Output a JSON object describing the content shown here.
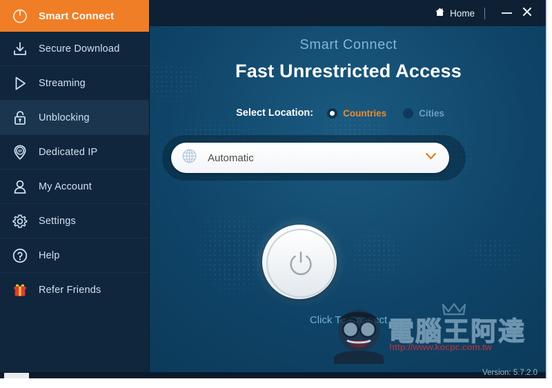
{
  "window": {
    "titlebar": {
      "home_label": "Home",
      "home_icon": "home-icon",
      "minimize_icon": "minimize-icon",
      "close_icon": "close-icon"
    },
    "version_text": "Version: 5.7.2.0"
  },
  "sidebar": {
    "header": {
      "label": "Smart Connect",
      "icon": "power-icon",
      "bg_color": "#ef7e27"
    },
    "items": [
      {
        "label": "Secure Download",
        "icon": "download-icon",
        "active": false
      },
      {
        "label": "Streaming",
        "icon": "play-icon",
        "active": false
      },
      {
        "label": "Unblocking",
        "icon": "unlock-icon",
        "active": true
      },
      {
        "label": "Dedicated IP",
        "icon": "ip-pin-icon",
        "active": false
      },
      {
        "label": "My Account",
        "icon": "user-icon",
        "active": false
      },
      {
        "label": "Settings",
        "icon": "gear-icon",
        "active": false
      },
      {
        "label": "Help",
        "icon": "question-icon",
        "active": false
      },
      {
        "label": "Refer Friends",
        "icon": "gift-icon",
        "active": false
      }
    ]
  },
  "main": {
    "eyebrow": "Smart Connect",
    "headline": "Fast Unrestricted Access",
    "select_location": {
      "label": "Select Location:",
      "options": [
        {
          "label": "Countries",
          "selected": true
        },
        {
          "label": "Cities",
          "selected": false
        }
      ]
    },
    "location_dropdown": {
      "value": "Automatic",
      "globe_icon": "globe-icon",
      "chevron_icon": "chevron-down-icon"
    },
    "power_button": {
      "icon": "power-icon",
      "caption": "Click To Connect"
    }
  },
  "watermark": {
    "text": "電腦王阿達",
    "url": "http://www.kocpc.com.tw"
  },
  "colors": {
    "accent_orange": "#ef7e27",
    "sidebar_bg": "#10263c",
    "titlebar_bg": "#0d2034",
    "main_bg": "#0f4468",
    "active_item_bg": "#1b354f"
  }
}
